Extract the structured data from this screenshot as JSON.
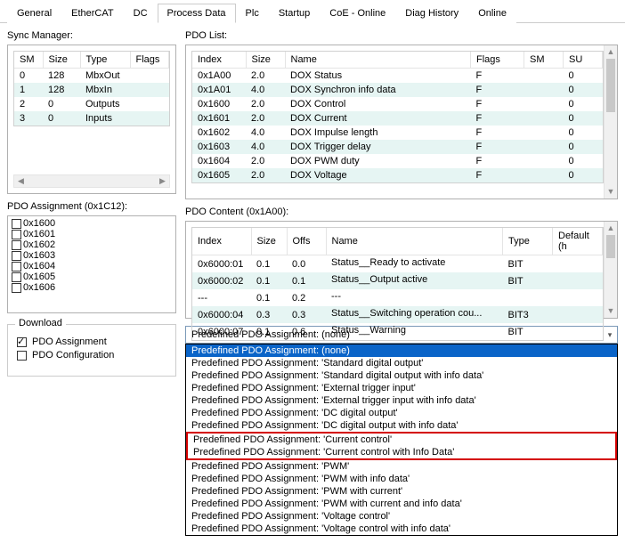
{
  "tabs": {
    "items": [
      "General",
      "EtherCAT",
      "DC",
      "Process Data",
      "Plc",
      "Startup",
      "CoE - Online",
      "Diag History",
      "Online"
    ],
    "active": "Process Data"
  },
  "syncManager": {
    "label": "Sync Manager:",
    "headers": [
      "SM",
      "Size",
      "Type",
      "Flags"
    ],
    "rows": [
      {
        "sm": "0",
        "size": "128",
        "type": "MbxOut",
        "flags": ""
      },
      {
        "sm": "1",
        "size": "128",
        "type": "MbxIn",
        "flags": ""
      },
      {
        "sm": "2",
        "size": "0",
        "type": "Outputs",
        "flags": ""
      },
      {
        "sm": "3",
        "size": "0",
        "type": "Inputs",
        "flags": ""
      }
    ]
  },
  "pdoList": {
    "label": "PDO List:",
    "headers": [
      "Index",
      "Size",
      "Name",
      "Flags",
      "SM",
      "SU"
    ],
    "rows": [
      {
        "index": "0x1A00",
        "size": "2.0",
        "name": "DOX Status",
        "flags": "F",
        "sm": "",
        "su": "0"
      },
      {
        "index": "0x1A01",
        "size": "4.0",
        "name": "DOX Synchron info data",
        "flags": "F",
        "sm": "",
        "su": "0"
      },
      {
        "index": "0x1600",
        "size": "2.0",
        "name": "DOX Control",
        "flags": "F",
        "sm": "",
        "su": "0"
      },
      {
        "index": "0x1601",
        "size": "2.0",
        "name": "DOX Current",
        "flags": "F",
        "sm": "",
        "su": "0"
      },
      {
        "index": "0x1602",
        "size": "4.0",
        "name": "DOX Impulse length",
        "flags": "F",
        "sm": "",
        "su": "0"
      },
      {
        "index": "0x1603",
        "size": "4.0",
        "name": "DOX Trigger delay",
        "flags": "F",
        "sm": "",
        "su": "0"
      },
      {
        "index": "0x1604",
        "size": "2.0",
        "name": "DOX PWM duty",
        "flags": "F",
        "sm": "",
        "su": "0"
      },
      {
        "index": "0x1605",
        "size": "2.0",
        "name": "DOX Voltage",
        "flags": "F",
        "sm": "",
        "su": "0"
      }
    ]
  },
  "pdoAssignment": {
    "label": "PDO Assignment (0x1C12):",
    "items": [
      "0x1600",
      "0x1601",
      "0x1602",
      "0x1603",
      "0x1604",
      "0x1605",
      "0x1606"
    ]
  },
  "pdoContent": {
    "label": "PDO Content (0x1A00):",
    "headers": [
      "Index",
      "Size",
      "Offs",
      "Name",
      "Type",
      "Default (h"
    ],
    "rows": [
      {
        "index": "0x6000:01",
        "size": "0.1",
        "offs": "0.0",
        "name": "Status__Ready to activate",
        "type": "BIT",
        "def": ""
      },
      {
        "index": "0x6000:02",
        "size": "0.1",
        "offs": "0.1",
        "name": "Status__Output active",
        "type": "BIT",
        "def": ""
      },
      {
        "index": "---",
        "size": "0.1",
        "offs": "0.2",
        "name": "---",
        "type": "",
        "def": ""
      },
      {
        "index": "0x6000:04",
        "size": "0.3",
        "offs": "0.3",
        "name": "Status__Switching operation cou...",
        "type": "BIT3",
        "def": ""
      },
      {
        "index": "0x6000:07",
        "size": "0.1",
        "offs": "0.6",
        "name": "Status__Warning",
        "type": "BIT",
        "def": ""
      }
    ]
  },
  "download": {
    "legend": "Download",
    "chkAssign": {
      "label": "PDO Assignment",
      "checked": true
    },
    "chkConfig": {
      "label": "PDO Configuration",
      "checked": false
    }
  },
  "predefDropdown": {
    "label": "Predefined PDO Assignment: (none)",
    "items": [
      "Predefined PDO Assignment: (none)",
      "Predefined PDO Assignment: 'Standard digital output'",
      "Predefined PDO Assignment: 'Standard digital output with info data'",
      "Predefined PDO Assignment: 'External trigger input'",
      "Predefined PDO Assignment: 'External trigger input with info data'",
      "Predefined PDO Assignment: 'DC digital output'",
      "Predefined PDO Assignment: 'DC digital output with info data'",
      "Predefined PDO Assignment: 'Current control'",
      "Predefined PDO Assignment: 'Current control with Info Data'",
      "Predefined PDO Assignment: 'PWM'",
      "Predefined PDO Assignment: 'PWM with info data'",
      "Predefined PDO Assignment: 'PWM with current'",
      "Predefined PDO Assignment: 'PWM with current and info data'",
      "Predefined PDO Assignment: 'Voltage control'",
      "Predefined PDO Assignment: 'Voltage control with info data'"
    ],
    "selected": 0,
    "highlighted": [
      7,
      8
    ]
  }
}
